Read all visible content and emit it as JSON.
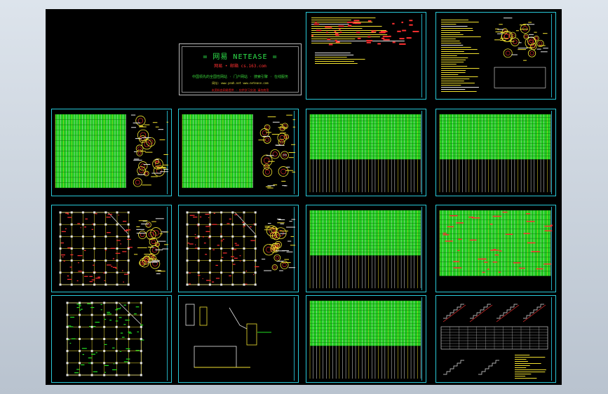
{
  "viewer": {
    "background": "CAD model space"
  },
  "logo_panel": {
    "line1": "= 网易  NETEASE =",
    "line2": "网易 • 邮箱      cs.163.com",
    "line3": "中国领先的全国性网站 · 门户网站 · 搜索引擎 · 在线服务",
    "line4": "网址: www.yeah.net  www.netease.com",
    "line5": "本资料由网易提供  ·  仅供学习交流  请勿商用"
  },
  "sheets": [
    {
      "id": "s-top-1",
      "kind": "plan-notes"
    },
    {
      "id": "s-top-2",
      "kind": "details-notes"
    },
    {
      "id": "s-r1-1",
      "kind": "table-details"
    },
    {
      "id": "s-r1-2",
      "kind": "table-details"
    },
    {
      "id": "s-r1-3",
      "kind": "table"
    },
    {
      "id": "s-r1-4",
      "kind": "table"
    },
    {
      "id": "s-r2-1",
      "kind": "plan"
    },
    {
      "id": "s-r2-2",
      "kind": "plan"
    },
    {
      "id": "s-r2-3",
      "kind": "table"
    },
    {
      "id": "s-r2-4",
      "kind": "table-red"
    },
    {
      "id": "s-r3-1",
      "kind": "grid-plan"
    },
    {
      "id": "s-r3-2",
      "kind": "sections"
    },
    {
      "id": "s-r3-3",
      "kind": "table"
    },
    {
      "id": "s-r3-4",
      "kind": "stairs"
    }
  ],
  "colors": {
    "frame": "#28c8d8",
    "table_green": "#22e022",
    "line_yellow": "#f0e030",
    "line_red": "#ff3030",
    "line_white": "#e6e6e6"
  }
}
